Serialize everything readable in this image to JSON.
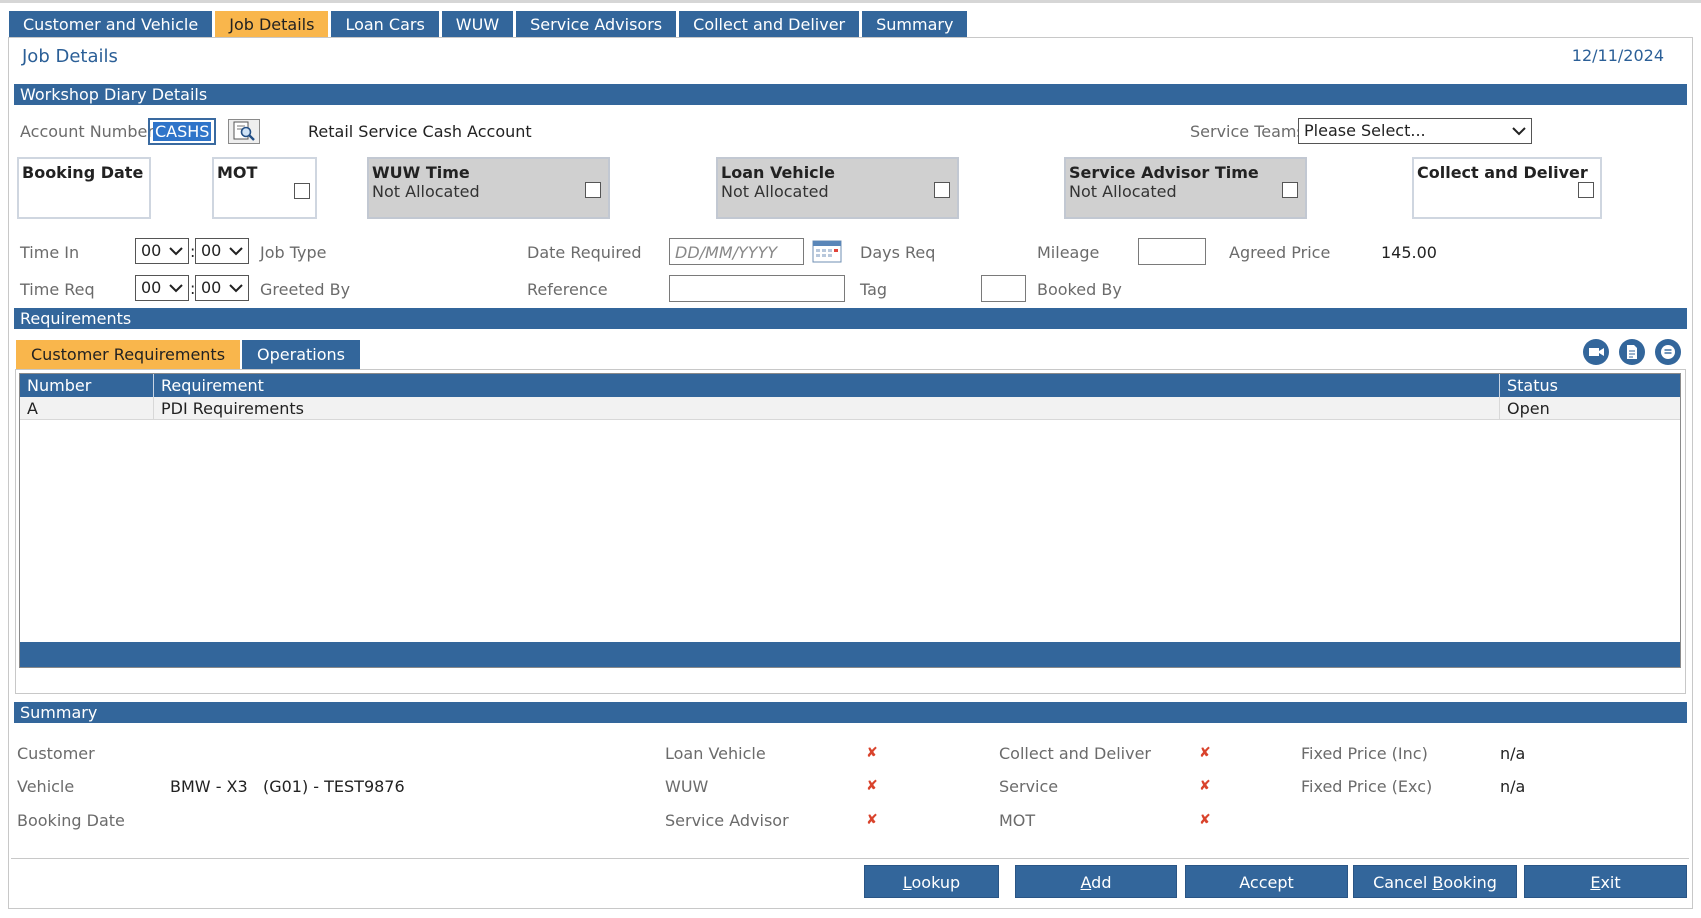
{
  "tabs": [
    {
      "label": "Customer and Vehicle",
      "active": false
    },
    {
      "label": "Job Details",
      "active": true
    },
    {
      "label": "Loan Cars",
      "active": false
    },
    {
      "label": "WUW",
      "active": false
    },
    {
      "label": "Service Advisors",
      "active": false
    },
    {
      "label": "Collect and Deliver",
      "active": false
    },
    {
      "label": "Summary",
      "active": false
    }
  ],
  "page": {
    "title": "Job Details",
    "date": "12/11/2024"
  },
  "diary": {
    "section_title": "Workshop Diary Details",
    "account_label": "Account Number",
    "account_value": "CASHS",
    "account_name": "Retail Service Cash Account",
    "service_teams_label": "Service Teams",
    "service_teams_value": "Please Select...",
    "booking_date_label": "Booking Date",
    "mot_label": "MOT",
    "wuw_label": "WUW Time",
    "wuw_status": "Not Allocated",
    "loan_label": "Loan Vehicle",
    "loan_status": "Not Allocated",
    "advisor_label": "Service Advisor Time",
    "advisor_status": "Not Allocated",
    "collect_label": "Collect and Deliver",
    "time_in_label": "Time In",
    "time_in_hh": "00",
    "time_in_mm": "00",
    "time_req_label": "Time Req",
    "time_req_hh": "00",
    "time_req_mm": "00",
    "time_sep": ":",
    "job_type_label": "Job Type",
    "greeted_by_label": "Greeted By",
    "date_required_label": "Date Required",
    "date_required_placeholder": "DD/MM/YYYY",
    "reference_label": "Reference",
    "days_req_label": "Days Req",
    "tag_label": "Tag",
    "mileage_label": "Mileage",
    "booked_by_label": "Booked By",
    "agreed_price_label": "Agreed Price",
    "agreed_price_value": "145.00"
  },
  "requirements": {
    "section_title": "Requirements",
    "subtabs": [
      {
        "label": "Customer Requirements",
        "active": true
      },
      {
        "label": "Operations",
        "active": false
      }
    ],
    "columns": [
      "Number",
      "Requirement",
      "Status"
    ],
    "rows": [
      {
        "number": "A",
        "requirement": "PDI Requirements",
        "status": "Open"
      }
    ],
    "icons": [
      "video-icon",
      "document-icon",
      "message-icon"
    ]
  },
  "summary": {
    "section_title": "Summary",
    "customer_label": "Customer",
    "customer_value": "",
    "vehicle_label": "Vehicle",
    "vehicle_value": "BMW - X3   (G01) - TEST9876",
    "booking_date_label": "Booking Date",
    "booking_date_value": "",
    "loan_vehicle_label": "Loan Vehicle",
    "wuw_label": "WUW",
    "service_advisor_label": "Service Advisor",
    "collect_label": "Collect and Deliver",
    "service_label": "Service",
    "mot_label": "MOT",
    "fixed_inc_label": "Fixed Price (Inc)",
    "fixed_inc_value": "n/a",
    "fixed_exc_label": "Fixed Price (Exc)",
    "fixed_exc_value": "n/a",
    "x_mark": "✘"
  },
  "buttons": {
    "lookup": {
      "first": "L",
      "rest": "ookup"
    },
    "add": {
      "first": "A",
      "rest": "dd"
    },
    "accept": {
      "first": "",
      "rest": "Accept"
    },
    "cancel": {
      "pre": "Cancel ",
      "ul": "B",
      "post": "ooking"
    },
    "exit": {
      "first": "E",
      "rest": "xit"
    }
  },
  "colors": {
    "accent": "#33669b",
    "active_tab": "#f9b64c",
    "title_text": "#2b5f97",
    "error_mark": "#d9432c"
  }
}
